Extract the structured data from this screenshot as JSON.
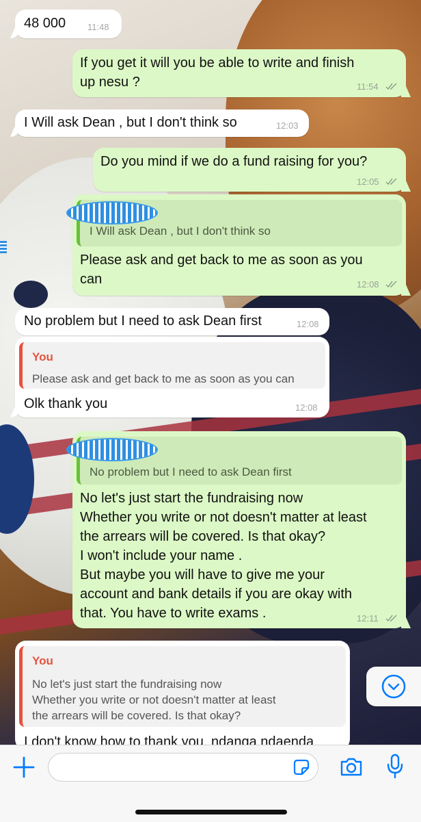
{
  "colors": {
    "accent": "#007aff",
    "outgoing_bubble": "#dcf8c6",
    "incoming_bubble": "#ffffff",
    "reply_name": "#e5533e",
    "reply_bar_out": "#6bbf3a"
  },
  "messages": [
    {
      "dir": "in",
      "text": "48 000",
      "time": "11:48"
    },
    {
      "dir": "out",
      "text": "If you get it will you be able to write and finish\nup nesu ?",
      "time": "11:54",
      "ticks": "read-ticks-icon"
    },
    {
      "dir": "in",
      "text": "I Will ask Dean , but I don't think so",
      "time": "12:03"
    },
    {
      "dir": "out",
      "text": "Do you mind if we do a fund raising for you?",
      "time": "12:05",
      "ticks": "read-ticks-icon"
    },
    {
      "dir": "out",
      "reply_to": "I Will ask Dean , but I don't think so",
      "text": "Please ask and get back to me as soon as you\ncan",
      "time": "12:08",
      "ticks": "read-ticks-icon"
    },
    {
      "dir": "in",
      "text": "No problem but I need to ask Dean first",
      "time": "12:08"
    },
    {
      "dir": "in",
      "reply_name": "You",
      "reply_to": "Please ask and get back to me as soon as you can",
      "text": "Olk thank you",
      "time": "12:08"
    },
    {
      "dir": "out",
      "reply_to": "No problem but I need to ask Dean first",
      "text": "No let's just start the fundraising now\nWhether you write or not doesn't matter at least\nthe arrears will be covered. Is that okay?\nI won't include your name .\nBut maybe you will have to give me your\naccount and bank details if you are okay with\nthat. You have to write exams .",
      "time": "12:11",
      "ticks": "read-ticks-icon"
    },
    {
      "dir": "in",
      "reply_name": "You",
      "reply_to": "No let's just start the fundraising now\nWhether you write or not doesn't matter at least\nthe arrears will be covered. Is that okay?",
      "text": "I don't know how to thank you, ndanga ndaenda"
    }
  ],
  "composer": {
    "plus_icon": "plus-icon",
    "sticker_icon": "sticker-icon",
    "camera_icon": "camera-icon",
    "mic_icon": "microphone-icon",
    "input_value": ""
  },
  "scroll_down_icon": "chevron-down-circle-icon"
}
